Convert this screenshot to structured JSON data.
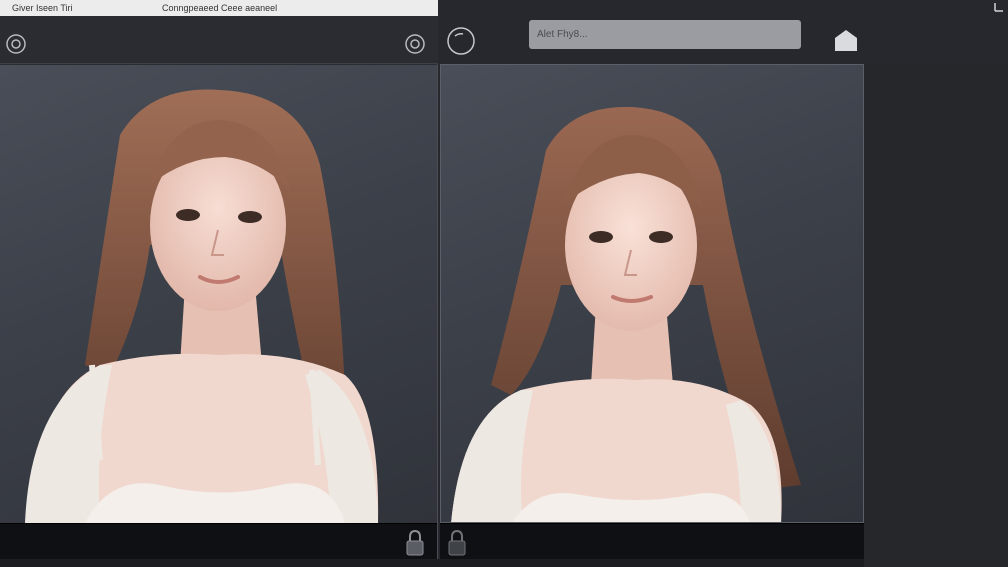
{
  "top_bar": {
    "tab_a": "Giver Iseen Tiri",
    "tab_b": "Conngpeaeed Ceee aeaneel"
  },
  "search": {
    "placeholder": "Alet Fhy8..."
  },
  "icons": {
    "left_toolbar_left": "target-icon",
    "left_toolbar_right": "target-icon",
    "right_header_left": "circle-icon",
    "right_header_home": "home-icon",
    "bottom_left": "lock-icon",
    "bottom_right": "lock-icon",
    "top_right_corner": "menu-icon"
  },
  "colors": {
    "background": "#26282d",
    "viewer_bg": "#3c4049",
    "search_bg": "#9a9ca1",
    "hair": "#8a5b45",
    "skin": "#f0d2c8",
    "clothing": "#eee8e3"
  }
}
